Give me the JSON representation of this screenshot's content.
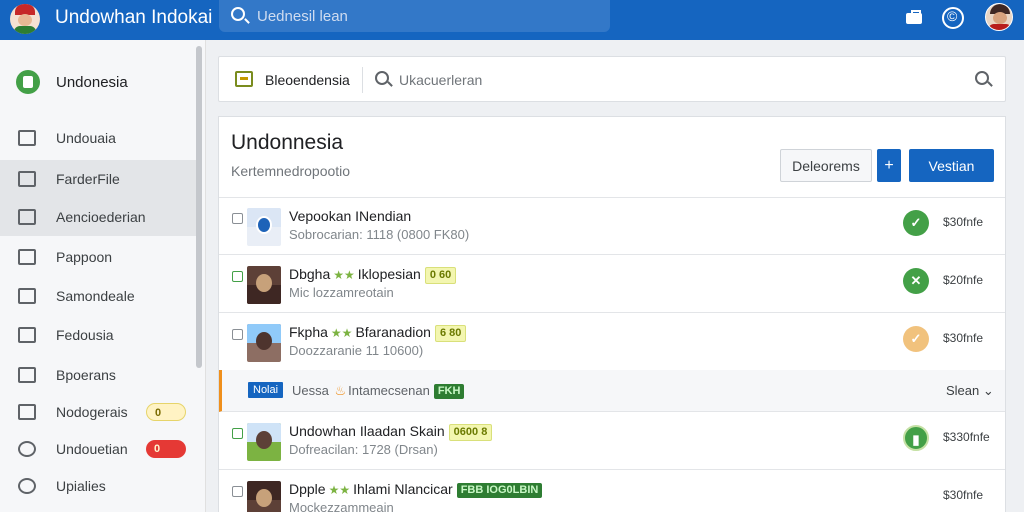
{
  "topbar": {
    "app_title": "Undowhan Indokai",
    "search_placeholder": "Uednesil lean",
    "icons": [
      "app-logo",
      "briefcase-icon",
      "help-icon",
      "user-avatar"
    ]
  },
  "sidebar": {
    "header": "Undonesia",
    "items": [
      {
        "label": "Undouaia",
        "icon": "building-icon"
      },
      {
        "label": "FarderFile",
        "icon": "folder-icon",
        "active": true
      },
      {
        "label": "Aencioederian",
        "icon": "home-icon",
        "active": true
      },
      {
        "label": "Pappoon",
        "icon": "image-icon"
      },
      {
        "label": "Samondeale",
        "icon": "calendar-icon"
      },
      {
        "label": "Fedousia",
        "icon": "document-icon"
      },
      {
        "label": "Bpoerans",
        "icon": "inbox-icon"
      },
      {
        "label": "Nodogerais",
        "icon": "grid-icon",
        "badge": "0"
      },
      {
        "label": "Undouetian",
        "icon": "circle-icon",
        "badge": "0"
      },
      {
        "label": "Upialies",
        "icon": "status-icon"
      }
    ]
  },
  "toolbar": {
    "tab_label": "Bleoendensia",
    "filter_placeholder": "Ukacuerleran"
  },
  "panel": {
    "title": "Undonnesia",
    "subtitle": "Kertemnedropootio",
    "button_outline": "Deleorems",
    "button_plus": "+",
    "button_primary": "Vestian"
  },
  "rows": [
    {
      "name": "Vepookan INendian",
      "meta": "Sobrocarian: 1118 (0800 FK80)",
      "status": "✓",
      "status_color": "#43a047",
      "price": "$30fnfe"
    },
    {
      "name": "Dbgha",
      "stars": "★★",
      "name2": "Iklopesian",
      "tag": "0 60",
      "meta": "Mic lozzamreotain",
      "status": "✕",
      "status_color": "#43a047",
      "price": "$20fnfe",
      "checked": true
    },
    {
      "name": "Fkpha",
      "stars": "★★",
      "name2": "Bfaranadion",
      "tag": "6 80",
      "meta": "Doozzaranie 11 10600)",
      "status": "✓",
      "status_color": "#f1c27d",
      "price": "$30fnfe"
    }
  ],
  "group": {
    "tag": "Nolai",
    "text1": "Uessa",
    "text2": "Intamecsenan",
    "badge": "FKH",
    "sort": "Slean"
  },
  "rows2": [
    {
      "name": "Undowhan Ilaadan Skain",
      "tag": "0600 8",
      "meta": "Dofreacilan: 1728 (Drsan)",
      "status": "▮",
      "status_color": "#43a047",
      "price": "$330fnfe",
      "checked": true
    },
    {
      "name": "Dpple",
      "stars": "★★",
      "name2": "Ihlami Nlancicar",
      "tag": "FBB IOG0LBIN",
      "meta": "Mockezzammeain",
      "price": "$30fnfe"
    }
  ]
}
